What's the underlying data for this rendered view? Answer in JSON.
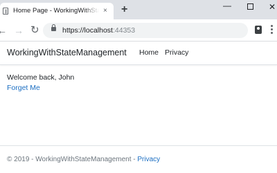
{
  "browser": {
    "tab_title": "Home Page - WorkingWithStateManagement",
    "tab_close": "×",
    "new_tab": "+",
    "url_host": "https://localhost",
    "url_port": ":44353",
    "icons": {
      "back": "←",
      "forward": "→",
      "reload": "↻",
      "minimize": "—",
      "close": "✕"
    }
  },
  "site": {
    "brand": "WorkingWithStateManagement",
    "nav": [
      {
        "label": "Home"
      },
      {
        "label": "Privacy"
      }
    ]
  },
  "main": {
    "welcome": "Welcome back, John",
    "forget_link": "Forget Me"
  },
  "footer": {
    "copyright": "© 2019 - WorkingWithStateManagement - ",
    "privacy_link": "Privacy"
  },
  "colors": {
    "link": "#1b6ec2",
    "text": "#212529",
    "muted": "#6c757d",
    "tabstrip": "#dee1e6"
  }
}
